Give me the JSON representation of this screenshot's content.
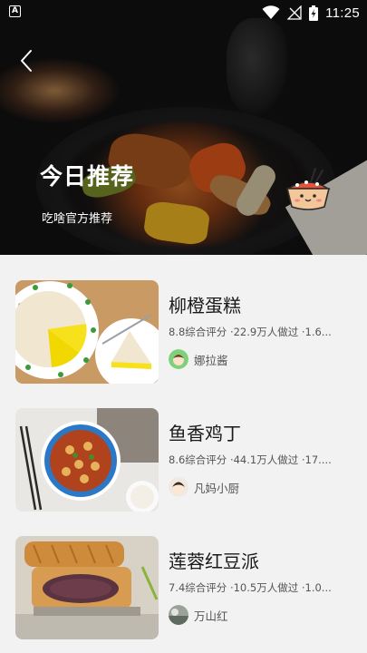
{
  "status_bar": {
    "time": "11:25",
    "left_icon_letter": "A"
  },
  "hero": {
    "title": "今日推荐",
    "subtitle": "吃啥官方推荐"
  },
  "recipes": [
    {
      "title": "柳橙蛋糕",
      "meta": "8.8综合评分 ·22.9万人做过 ·1.6...",
      "author": "娜拉酱"
    },
    {
      "title": "鱼香鸡丁",
      "meta": "8.6综合评分 ·44.1万人做过 ·17....",
      "author": "凡妈小厨"
    },
    {
      "title": "莲蓉红豆派",
      "meta": "7.4综合评分 ·10.5万人做过 ·1.0...",
      "author": "万山红"
    }
  ],
  "icons": [
    "back-icon",
    "wifi-icon",
    "no-signal-icon",
    "battery-icon",
    "mascot-icon"
  ]
}
